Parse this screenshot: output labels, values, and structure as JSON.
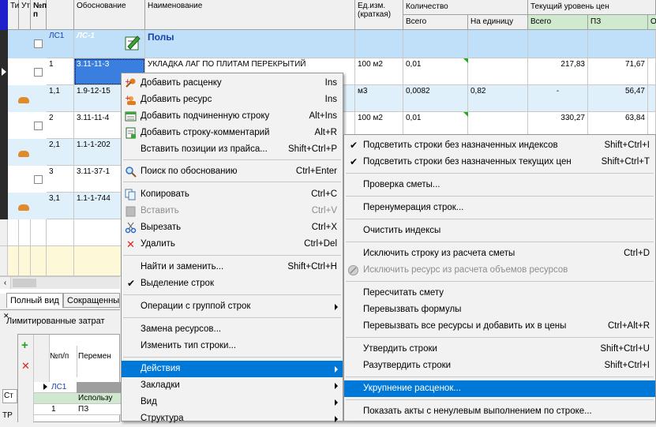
{
  "grid": {
    "headers": {
      "ti": "Ти",
      "ut": "Ут",
      "num": "№п/п",
      "basis": "Обоснование",
      "name": "Наименование",
      "unit": "Ед.изм. (краткая)",
      "qty_group": "Количество",
      "qty_total": "Всего",
      "qty_per": "На единицу",
      "price_group": "Текущий уровень цен",
      "price_total": "Всего",
      "price_pz": "ПЗ",
      "price_o": "О"
    },
    "rows": [
      {
        "num": "ЛС1",
        "basis": "ЛС-1",
        "name": "Полы",
        "unit": "",
        "qty_total": "",
        "qty_per": "",
        "price_total": "",
        "price_pz": ""
      },
      {
        "num": "1",
        "basis": "3.11-11-3",
        "name": "УКЛАДКА ЛАГ ПО ПЛИТАМ ПЕРЕКРЫТИЙ",
        "unit": "100 м2",
        "qty_total": "0,01",
        "qty_per": "",
        "price_total": "217,83",
        "price_pz": "71,67"
      },
      {
        "num": "1,1",
        "basis": "1.9-12-15",
        "name": "",
        "unit": "м3",
        "qty_total": "0,0082",
        "qty_per": "0,82",
        "price_total": "-",
        "price_pz": "56,47"
      },
      {
        "num": "2",
        "basis": "3.11-11-4",
        "name": "",
        "unit": "100 м2",
        "qty_total": "0,01",
        "qty_per": "",
        "price_total": "330,27",
        "price_pz": "63,84"
      },
      {
        "num": "2,1",
        "basis": "1.1-1-202",
        "name": "",
        "unit": "",
        "qty_total": "",
        "qty_per": "",
        "price_total": "",
        "price_pz": ""
      },
      {
        "num": "3",
        "basis": "3.11-37-1",
        "name": "",
        "unit": "",
        "qty_total": "",
        "qty_per": "",
        "price_total": "",
        "price_pz": ""
      },
      {
        "num": "3,1",
        "basis": "1.1-1-744",
        "name": "",
        "unit": "",
        "qty_total": "",
        "qty_per": "",
        "price_total": "",
        "price_pz": ""
      }
    ]
  },
  "tabs": {
    "full": "Полный вид",
    "short": "Сокращенны"
  },
  "lower": {
    "title": "Лимитированные затрат",
    "col_num": "№п/п",
    "col_var": "Перемен",
    "tab_st": "Ст",
    "tab_tr": "ТР",
    "row1_num": "ЛС1",
    "row2_text": "Использу",
    "row3_num": "1",
    "row3_val": "ПЗ"
  },
  "context_menu": {
    "items": [
      {
        "label": "Добавить расценку",
        "shortcut": "Ins",
        "icon": "add-rate-icon"
      },
      {
        "label": "Добавить ресурс",
        "shortcut": "Ins",
        "icon": "add-resource-icon"
      },
      {
        "label": "Добавить подчиненную строку",
        "shortcut": "Alt+Ins",
        "icon": "add-child-row-icon"
      },
      {
        "label": "Добавить строку-комментарий",
        "shortcut": "Alt+R",
        "icon": "add-comment-icon"
      },
      {
        "label": "Вставить позиции из прайса...",
        "shortcut": "Shift+Ctrl+P"
      },
      {
        "label": "Поиск по обоснованию",
        "shortcut": "Ctrl+Enter",
        "icon": "search-icon"
      },
      {
        "label": "Копировать",
        "shortcut": "Ctrl+C",
        "icon": "copy-icon"
      },
      {
        "label": "Вставить",
        "shortcut": "Ctrl+V",
        "icon": "paste-icon"
      },
      {
        "label": "Вырезать",
        "shortcut": "Ctrl+X",
        "icon": "cut-icon"
      },
      {
        "label": "Удалить",
        "shortcut": "Ctrl+Del",
        "icon": "delete-icon"
      },
      {
        "label": "Найти и заменить...",
        "shortcut": "Shift+Ctrl+H"
      },
      {
        "label": "Выделение строк",
        "shortcut": ""
      },
      {
        "label": "Операции с группой строк"
      },
      {
        "label": "Замена ресурсов..."
      },
      {
        "label": "Изменить тип строки..."
      },
      {
        "label": "Действия"
      },
      {
        "label": "Закладки"
      },
      {
        "label": "Вид"
      },
      {
        "label": "Структура"
      }
    ]
  },
  "submenu": {
    "items": [
      {
        "label": "Подсветить строки без назначенных индексов",
        "shortcut": "Shift+Ctrl+I"
      },
      {
        "label": "Подсветить строки без назначенных текущих цен",
        "shortcut": "Shift+Ctrl+T"
      },
      {
        "label": "Проверка сметы..."
      },
      {
        "label": "Перенумерация строк..."
      },
      {
        "label": "Очистить индексы"
      },
      {
        "label": "Исключить строку из расчета сметы",
        "shortcut": "Ctrl+D"
      },
      {
        "label": "Исключить ресурс из расчета объемов ресурсов"
      },
      {
        "label": "Пересчитать смету"
      },
      {
        "label": "Перевызвать формулы"
      },
      {
        "label": "Перевызвать все ресурсы и добавить их в цены",
        "shortcut": "Ctrl+Alt+R"
      },
      {
        "label": "Утвердить строки",
        "shortcut": "Shift+Ctrl+U"
      },
      {
        "label": "Разутвердить строки",
        "shortcut": "Shift+Ctrl+I"
      },
      {
        "label": "Укрупнение расценок..."
      },
      {
        "label": "Показать акты с ненулевым выполнением по строке..."
      }
    ]
  },
  "colors": {
    "highlight": "#0078d7",
    "section_row": "#bfe0f8",
    "selected_cell": "#3a7fe0"
  }
}
